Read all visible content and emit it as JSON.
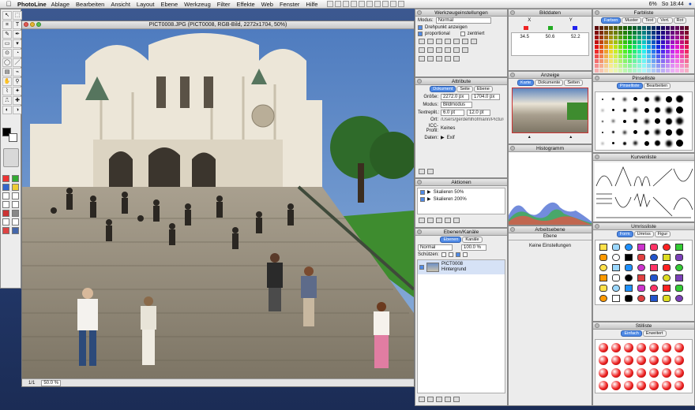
{
  "menubar": {
    "apple": "",
    "app_name": "PhotoLine",
    "menus": [
      "Ablage",
      "Bearbeiten",
      "Ansicht",
      "Layout",
      "Ebene",
      "Werkzeug",
      "Filter",
      "Effekte",
      "Web",
      "Fenster",
      "Hilfe"
    ],
    "battery": "6%",
    "clock": "So 18:44"
  },
  "document": {
    "title": "PICT0008.JPG (PICT0008, RGB-Bild, 2272x1704, 50%)",
    "page": "1/1",
    "zoom": "50.0 %"
  },
  "werkzeug": {
    "title": "Werkzeugeinstellungen",
    "modus_label": "Modus:",
    "modus_value": "Normal",
    "opt1": "Drehpunkt anzeigen",
    "opt2": "proportional",
    "opt3": "zentriert"
  },
  "attribute": {
    "title": "Attribute",
    "tabs": [
      "Dokument",
      "Seite",
      "Ebene"
    ],
    "groesse_label": "Größe:",
    "width": "2272.0 px",
    "height": "1704.0 px",
    "modus_label": "Modus:",
    "modus_value": "Bildmodus",
    "text_label": "Textreplit.:",
    "text_size": "6.0 pt",
    "text_lead": "12.0 pt",
    "ort_label": "Ort:",
    "ort_value": "/Users/gerdehlhofmann/Pictures/Par",
    "icc_label": "ICC-Profil:",
    "icc_value": "Keines",
    "daten_label": "Daten:",
    "daten_value": "Exif"
  },
  "aktionen": {
    "title": "Aktionen",
    "items": [
      "Skalieren 50%",
      "Skalieren 200%"
    ]
  },
  "ebenen": {
    "title": "Ebenen/Kanäle",
    "tabs": [
      "Ebenen",
      "Kanäle"
    ],
    "mode": "Normal",
    "opacity": "100.0 %",
    "schuetzen": "Schützen:",
    "layer_name": "PICT0008",
    "layer_sub": "Hintergrund"
  },
  "bilddaten": {
    "title": "Bilddaten",
    "cols": [
      "X",
      "Y",
      "R",
      "G",
      "B"
    ],
    "values": [
      "34.5",
      "50.6",
      "52.2"
    ]
  },
  "anzeige": {
    "title": "Anzeige",
    "tabs": [
      "Karte",
      "Dokumente",
      "Seiten"
    ]
  },
  "histogramm": {
    "title": "Histogramm"
  },
  "arbeitsebene": {
    "title": "Arbeitsebene",
    "subtitle": "Ebene",
    "note": "Keine Einstellungen"
  },
  "farbliste": {
    "title": "Farbliste",
    "tabs": [
      "Farben",
      "Muster",
      "Text",
      "Vert.",
      "Rot"
    ]
  },
  "pinselliste": {
    "title": "Pinselliste",
    "tabs": [
      "Pinselliste",
      "Bearbeiten"
    ]
  },
  "kurvenliste": {
    "title": "Kurvenliste"
  },
  "umrissliste": {
    "title": "Umrissliste",
    "tabs": [
      "Form",
      "Umriss",
      "Figur"
    ]
  },
  "stilliste": {
    "title": "Stilliste",
    "tabs": [
      "Einfach",
      "Erweitert"
    ]
  },
  "colors": {
    "sky": "#5d84b9",
    "stone": "#e9e3d5",
    "accent": "#4f8ae6"
  }
}
